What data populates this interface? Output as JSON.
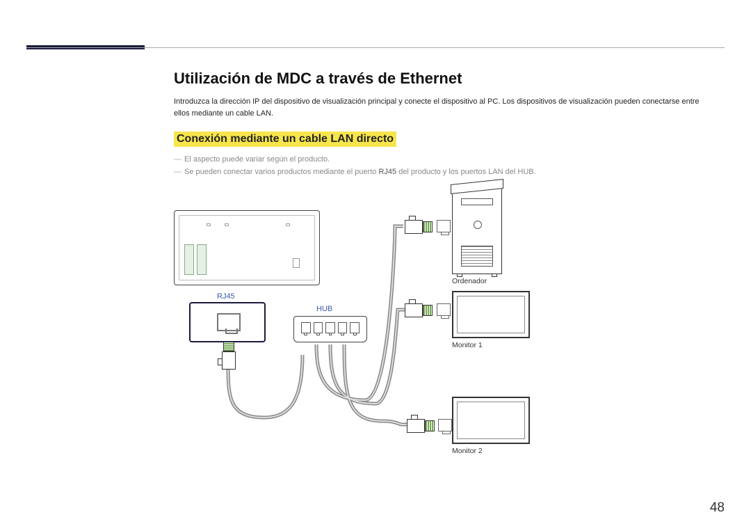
{
  "page": {
    "title": "Utilización de MDC a través de Ethernet",
    "intro": "Introduzca la dirección IP del dispositivo de visualización principal y conecte el dispositivo al PC. Los dispositivos de visualización pueden conectarse entre ellos mediante un cable LAN.",
    "sub_heading": "Conexión mediante un cable LAN directo",
    "notes": {
      "n1": "El aspecto puede variar según el producto.",
      "n2_pre": "Se pueden conectar varios productos mediante el puerto ",
      "n2_kw": "RJ45",
      "n2_post": " del producto y los puertos LAN del HUB."
    },
    "page_number": "48"
  },
  "diagram": {
    "rj45_label": "RJ45",
    "hub_label": "HUB",
    "computer_label": "Ordenador",
    "monitor1_label": "Monitor 1",
    "monitor2_label": "Monitor 2"
  }
}
